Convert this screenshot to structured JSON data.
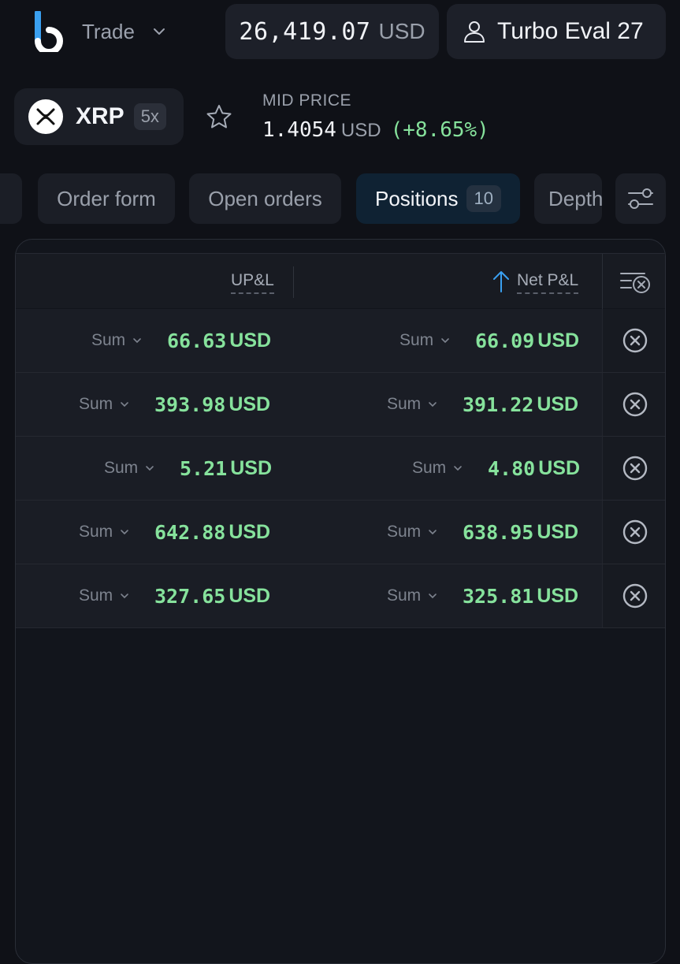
{
  "header": {
    "menu_label": "Trade",
    "balance_value": "26,419.07",
    "balance_currency": "USD",
    "account_name": "Turbo Eval 27"
  },
  "market": {
    "symbol": "XRP",
    "leverage": "5x",
    "mid_price_label": "MID PRICE",
    "mid_price": "1.4054",
    "mid_price_currency": "USD",
    "change": "(+8.65%)"
  },
  "tabs": [
    {
      "label": "Order form"
    },
    {
      "label": "Open orders"
    },
    {
      "label": "Positions",
      "count": "10",
      "active": true
    },
    {
      "label": "Depth"
    }
  ],
  "table": {
    "columns": [
      "UP&L",
      "Net P&L"
    ],
    "rows": [
      {
        "upl_agg": "Sum",
        "upl": "66.63",
        "net_agg": "Sum",
        "net": "66.09",
        "currency": "USD"
      },
      {
        "upl_agg": "Sum",
        "upl": "393.98",
        "net_agg": "Sum",
        "net": "391.22",
        "currency": "USD"
      },
      {
        "upl_agg": "Sum",
        "upl": "5.21",
        "net_agg": "Sum",
        "net": "4.80",
        "currency": "USD"
      },
      {
        "upl_agg": "Sum",
        "upl": "642.88",
        "net_agg": "Sum",
        "net": "638.95",
        "currency": "USD"
      },
      {
        "upl_agg": "Sum",
        "upl": "327.65",
        "net_agg": "Sum",
        "net": "325.81",
        "currency": "USD"
      }
    ]
  },
  "icons": {
    "logo": "brand-logo-icon",
    "menu": "chevron-down-icon",
    "account": "user-icon",
    "coin": "xrp-icon",
    "favorite": "star-icon",
    "filter": "sliders-icon",
    "sort": "arrow-up-icon",
    "close_all": "clear-all-icon",
    "close": "close-circle-icon"
  },
  "colors": {
    "positive": "#86e29c",
    "accent": "#3aa0f0",
    "active_tab": "#0f2233"
  }
}
